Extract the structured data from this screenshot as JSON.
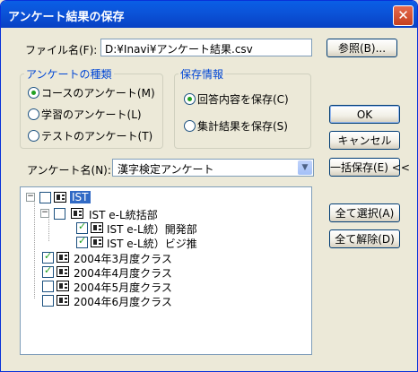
{
  "window": {
    "title": "アンケート結果の保存"
  },
  "filename": {
    "label": "ファイル名(F):",
    "value": "D:¥Inavi¥アンケート結果.csv",
    "browse_label": "参照(B)..."
  },
  "survey_type": {
    "title": "アンケートの種類",
    "options": [
      {
        "label": "コースのアンケート(M)",
        "selected": true
      },
      {
        "label": "学習のアンケート(L)",
        "selected": false
      },
      {
        "label": "テストのアンケート(T)",
        "selected": false
      }
    ]
  },
  "save_info": {
    "title": "保存情報",
    "options": [
      {
        "label": "回答内容を保存(C)",
        "selected": true
      },
      {
        "label": "集計結果を保存(S)",
        "selected": false
      }
    ]
  },
  "buttons": {
    "ok": "OK",
    "cancel": "キャンセル",
    "batch_save": "一括保存(E) <<",
    "select_all": "全て選択(A)",
    "deselect_all": "全て解除(D)"
  },
  "survey_name": {
    "label": "アンケート名(N):",
    "value": "漢字検定アンケート"
  },
  "tree": [
    {
      "label": "IST",
      "checked": false,
      "expanded": true,
      "selected": true
    },
    {
      "label": "IST e-L統括部",
      "checked": false,
      "expanded": true
    },
    {
      "label": "IST e-L統）開発部",
      "checked": true
    },
    {
      "label": "IST e-L統）ビジ推",
      "checked": true
    },
    {
      "label": "2004年3月度クラス",
      "checked": true
    },
    {
      "label": "2004年4月度クラス",
      "checked": true
    },
    {
      "label": "2004年5月度クラス",
      "checked": false
    },
    {
      "label": "2004年6月度クラス",
      "checked": false
    }
  ]
}
